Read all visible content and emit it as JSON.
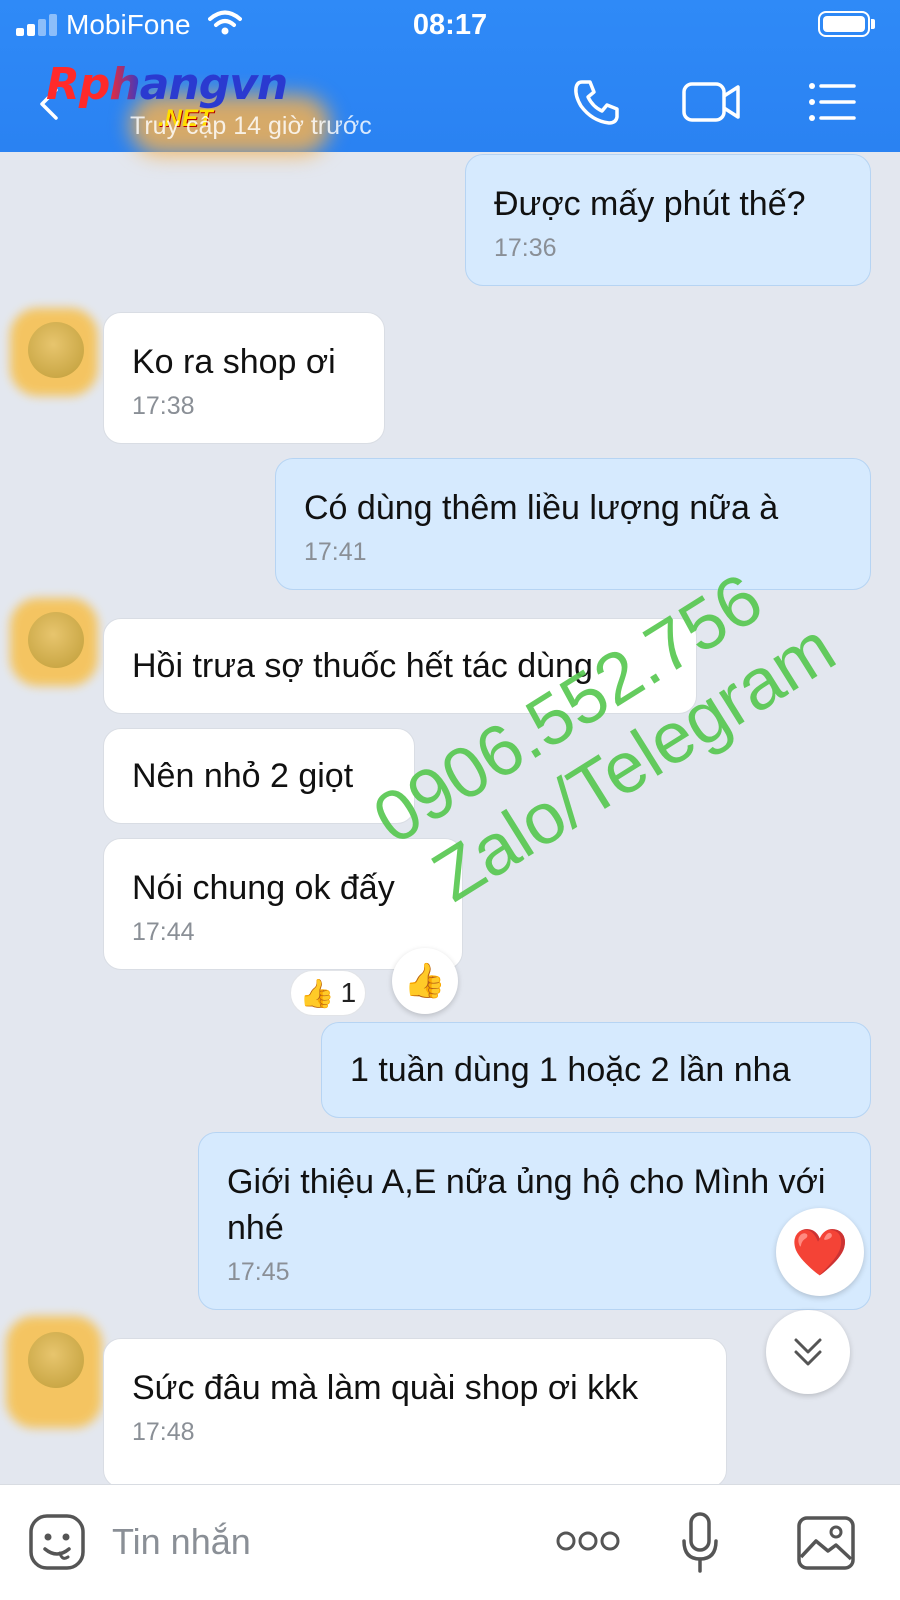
{
  "status_bar": {
    "carrier": "MobiFone",
    "time": "08:17"
  },
  "header": {
    "logo_main": "Rphangvn",
    "logo_sub": ".NET",
    "last_seen": "Truy cập 14 giờ trước",
    "icons": [
      "back-arrow-icon",
      "phone-icon",
      "video-call-icon",
      "menu-icon"
    ],
    "accent_color": "#2f8af7"
  },
  "messages": [
    {
      "direction": "out",
      "text": "Được mấy phút thế?",
      "time": "17:36"
    },
    {
      "direction": "in",
      "text": "Ko ra shop ơi",
      "time": "17:38"
    },
    {
      "direction": "out",
      "text": "Có dùng thêm liều lượng nữa à",
      "time": "17:41"
    },
    {
      "direction": "in",
      "text": "Hồi trưa sợ thuốc hết tác dùng"
    },
    {
      "direction": "in",
      "text": "Nên nhỏ 2 giọt"
    },
    {
      "direction": "in",
      "text": "Nói chung ok đấy",
      "time": "17:44"
    },
    {
      "direction": "out",
      "text": "1 tuần dùng 1 hoặc 2 lần nha"
    },
    {
      "direction": "out",
      "text": "Giới thiệu A,E nữa ủng hộ cho Mình với nhé",
      "time": "17:45"
    },
    {
      "direction": "in",
      "text": "Sức đâu mà làm quài shop ơi kkk",
      "time": "17:48"
    }
  ],
  "reaction": {
    "emoji": "👍",
    "count": "1"
  },
  "heart_emoji": "❤️",
  "thumbs_emoji": "👍",
  "watermark": {
    "line1": "0906.552.756",
    "line2": "Zalo/Telegram"
  },
  "input": {
    "placeholder": "Tin nhắn"
  }
}
